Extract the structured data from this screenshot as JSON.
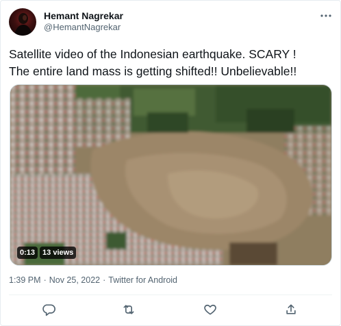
{
  "author": {
    "name": "Hemant Nagrekar",
    "handle": "@HemantNagrekar"
  },
  "tweet": {
    "text": "Satellite video of the Indonesian earthquake. SCARY !\nThe entire land mass is getting shifted!! Unbelievable!!"
  },
  "video": {
    "duration": "0:13",
    "views": "13 views"
  },
  "meta": {
    "time": "1:39 PM",
    "sep1": "·",
    "date": "Nov 25, 2022",
    "sep2": "·",
    "source": "Twitter for Android"
  },
  "icons": {
    "more": "more-dots-icon",
    "reply": "reply-icon",
    "retweet": "retweet-icon",
    "like": "like-icon",
    "share": "share-icon"
  },
  "colors": {
    "text": "#0f1419",
    "secondary": "#536471",
    "border": "#cfd9de"
  }
}
